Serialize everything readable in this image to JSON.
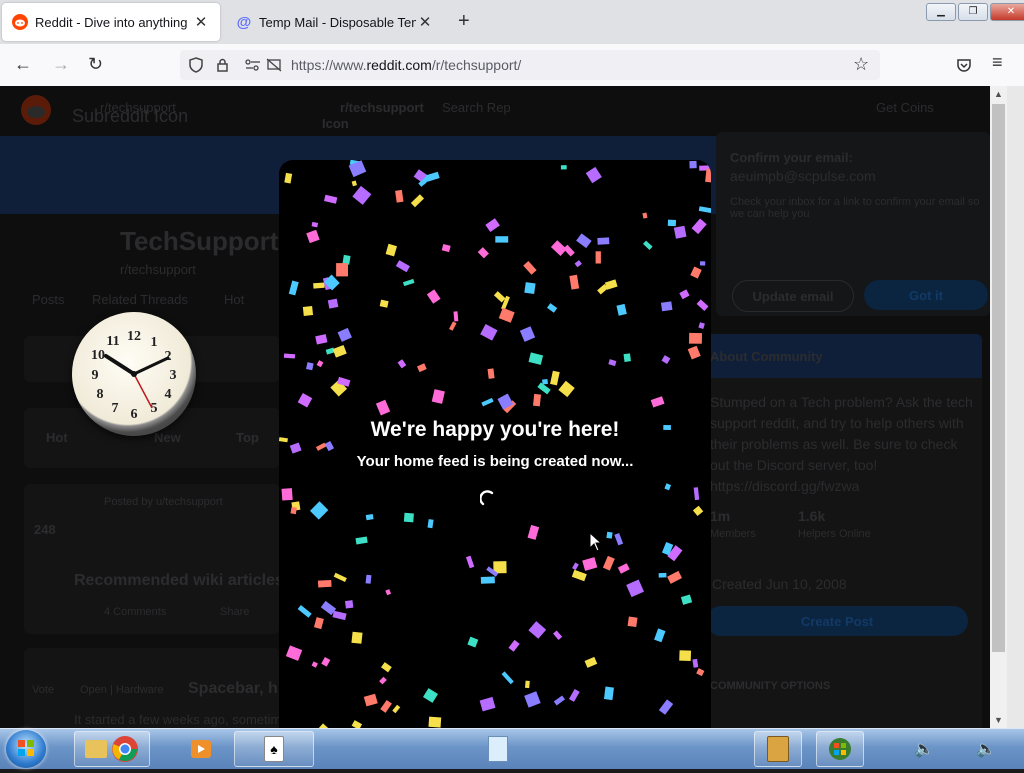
{
  "browser": {
    "tabs": [
      {
        "title": "Reddit - Dive into anything",
        "icon": "reddit-favicon-icon",
        "active": true
      },
      {
        "title": "Temp Mail - Disposable Tempor",
        "icon": "tempmail-favicon-icon",
        "active": false
      }
    ],
    "url_prefix": "https://www.",
    "url_domain": "reddit.com",
    "url_path": "/r/techsupport/"
  },
  "background_page": {
    "subreddit_icon_alt": "Subreddit Icon",
    "community_title": "TechSupport",
    "community_handle": "r/techsupport",
    "tabs": [
      "Posts",
      "Related Threads",
      "Hot"
    ],
    "search_left": "r/techsupport",
    "search_right": "r/techsupport",
    "search_placeholder": "Search Rep",
    "icon_alt_fragment": "Icon",
    "get_coins": "Get Coins",
    "confirm_email_title": "Confirm your email:",
    "confirm_email_address": "aeuimpb@scpulse.com",
    "confirm_email_body": "Check your inbox for a link to confirm your email so we can help you",
    "update_email": "Update email",
    "got_it": "Got it",
    "about_header": "About Community",
    "about_text": "Stumped on a Tech problem? Ask the tech support reddit, and try to help others with their problems as well. Be sure to check out the Discord server, too! https://discord.gg/fwzwa",
    "members_value": "1m",
    "members_label": "Members",
    "online_value": "1.6k",
    "online_label": "Helpers Online",
    "created": "Created Jun 10, 2008",
    "create_post": "Create Post",
    "community_options": "COMMUNITY OPTIONS",
    "sort_hot": "Hot",
    "sort_new": "New",
    "sort_top": "Top",
    "post1_votes": "248",
    "post1_meta": "Posted by u/techsupport",
    "post1_title": "Recommended wiki articles",
    "post1_comments": "4 Comments",
    "post1_share": "Share",
    "post2_label": "Vote",
    "post2_flair": "Open | Hardware",
    "post2_title": "Spacebar, h",
    "post2_body": "It started a few weeks ago, sometimes"
  },
  "modal": {
    "title": "We're happy you're here!",
    "subtitle": "Your home feed is being created now..."
  },
  "colors": {
    "reddit_orange": "#ff4500",
    "confetti": [
      "#b66cff",
      "#ff6bd8",
      "#3de0c4",
      "#4cc9ff",
      "#f5e04b",
      "#ff7a6b",
      "#8a7dff",
      "#d06bff"
    ]
  },
  "taskbar": {
    "items": [
      "start-orb-icon",
      "explorer-icon",
      "chrome-icon",
      "media-player-icon",
      "solitaire-icon",
      "notepad-icon",
      "calculator-icon",
      "windows-logo-icon",
      "volume-icon"
    ]
  }
}
